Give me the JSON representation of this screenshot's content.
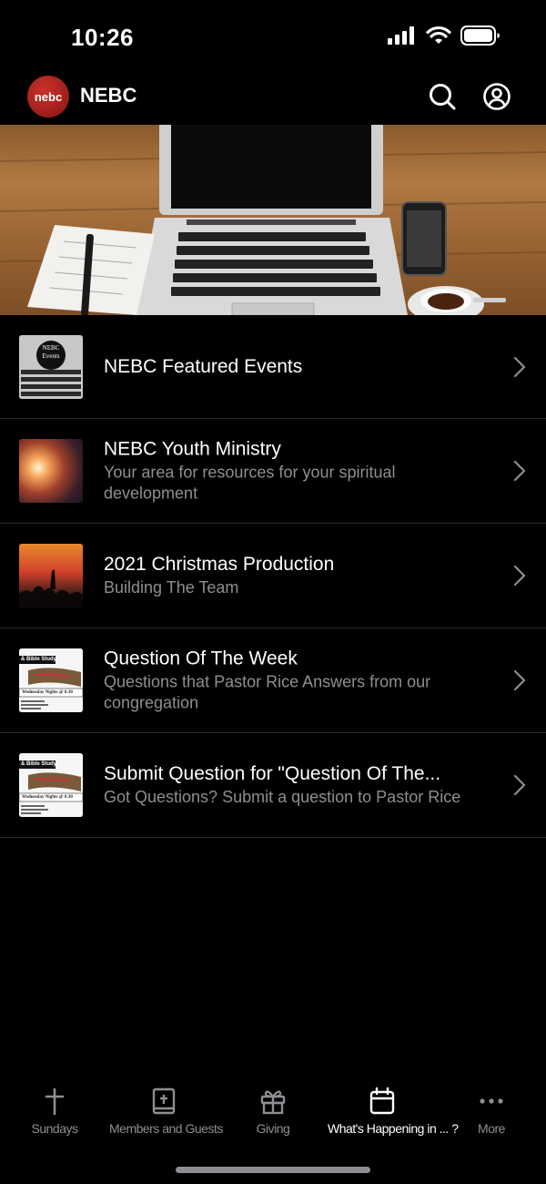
{
  "status_bar": {
    "time": "10:26"
  },
  "header": {
    "logo_text": "nebc",
    "title": "NEBC",
    "search_icon": "search-icon",
    "profile_icon": "account-icon"
  },
  "list": [
    {
      "title": "NEBC Featured Events",
      "subtitle": ""
    },
    {
      "title": "NEBC Youth Ministry",
      "subtitle": "Your area for resources for your spiritual development"
    },
    {
      "title": "2021 Christmas Production",
      "subtitle": "Building The Team"
    },
    {
      "title": "Question Of The Week",
      "subtitle": "Questions that Pastor Rice Answers from our congregation"
    },
    {
      "title": "Submit Question for \"Question Of The...",
      "subtitle": "Got Questions?  Submit a question to Pastor Rice"
    }
  ],
  "thumbs": {
    "events_label": "NEBC Events",
    "bible_study_label": "& Bible Study",
    "bible_study_banner": "Wednesday Nights @ 6:30"
  },
  "tabbar": {
    "tabs": [
      {
        "label": "Sundays",
        "icon": "cross-icon",
        "active": false
      },
      {
        "label": "Members and Guests",
        "icon": "bible-icon",
        "active": false
      },
      {
        "label": "Giving",
        "icon": "gift-icon",
        "active": false
      },
      {
        "label": "What's Happening in ... ?",
        "icon": "calendar-icon",
        "active": true
      },
      {
        "label": "More",
        "icon": "more-icon",
        "active": false
      }
    ]
  },
  "colors": {
    "background": "#000000",
    "secondary_text": "#8e8e93",
    "logo_red": "#b0201c"
  }
}
